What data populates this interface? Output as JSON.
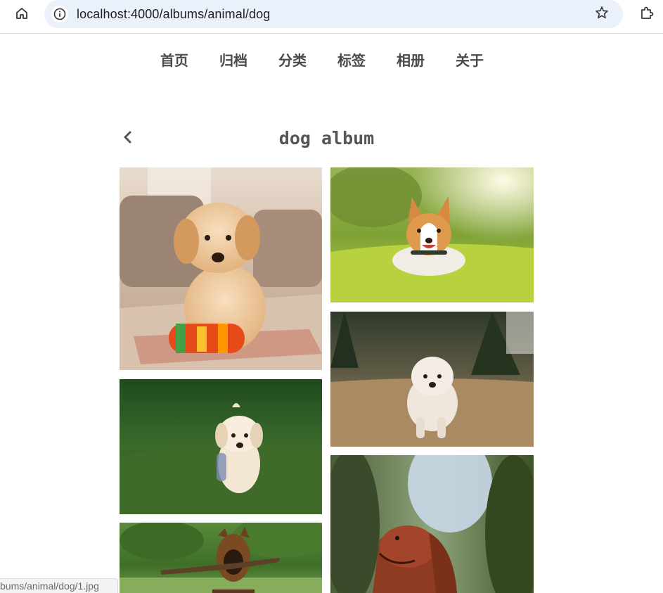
{
  "browser": {
    "url": "localhost:4000/albums/animal/dog",
    "status_url": "bums/animal/dog/1.jpg"
  },
  "nav": {
    "items": [
      {
        "label": "首页"
      },
      {
        "label": "归档"
      },
      {
        "label": "分类"
      },
      {
        "label": "标签"
      },
      {
        "label": "相册"
      },
      {
        "label": "关于"
      }
    ]
  },
  "album": {
    "title": "dog album",
    "photos": [
      {
        "alt": "golden puppy with toy"
      },
      {
        "alt": "corgi in grass"
      },
      {
        "alt": "white puppy walking on grass"
      },
      {
        "alt": "white fluffy dog in field"
      },
      {
        "alt": "german shepherd with stick"
      },
      {
        "alt": "irish setter looking up"
      }
    ]
  },
  "colors": {
    "nav_text": "#4b4b4b",
    "title_text": "#555555",
    "omnibox_bg": "#eaf1fb"
  }
}
